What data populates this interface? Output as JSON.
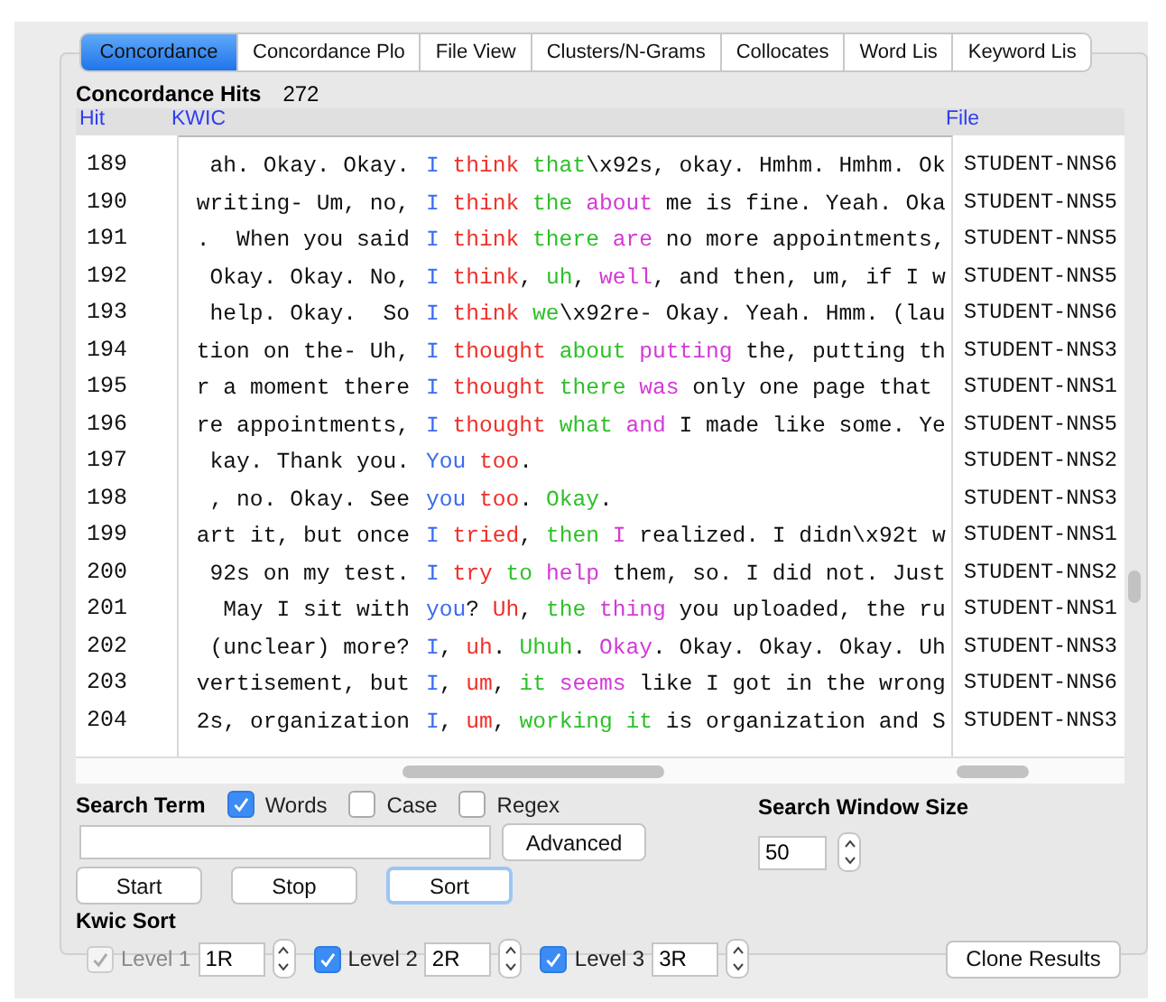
{
  "tabs": [
    {
      "label": "Concordance",
      "selected": true
    },
    {
      "label": "Concordance Plo",
      "selected": false
    },
    {
      "label": "File View",
      "selected": false
    },
    {
      "label": "Clusters/N-Grams",
      "selected": false
    },
    {
      "label": "Collocates",
      "selected": false
    },
    {
      "label": "Word Lis",
      "selected": false
    },
    {
      "label": "Keyword Lis",
      "selected": false
    }
  ],
  "hits": {
    "label": "Concordance Hits",
    "count": "272"
  },
  "table": {
    "columns": [
      "Hit",
      "KWIC",
      "File"
    ],
    "rows": [
      {
        "hit": "189",
        "left": "ah. Okay. Okay.",
        "right": [
          {
            "t": "I ",
            "color": "#3b6cf0"
          },
          {
            "t": "think ",
            "color": "#f0302a"
          },
          {
            "t": "that",
            "color": "#2fc02a"
          },
          {
            "t": "\\x92s, okay. Hmhm. Hmhm. Ok"
          }
        ],
        "file": "STUDENT-NNS6"
      },
      {
        "hit": "190",
        "left": "writing- Um, no,",
        "right": [
          {
            "t": "I ",
            "color": "#3b6cf0"
          },
          {
            "t": "think ",
            "color": "#f0302a"
          },
          {
            "t": "the ",
            "color": "#2fc02a"
          },
          {
            "t": "about",
            "color": "#d23ad6"
          },
          {
            "t": " me is fine. Yeah. Oka"
          }
        ],
        "file": "STUDENT-NNS5"
      },
      {
        "hit": "191",
        "left": ".  When you said",
        "right": [
          {
            "t": "I ",
            "color": "#3b6cf0"
          },
          {
            "t": "think ",
            "color": "#f0302a"
          },
          {
            "t": "there ",
            "color": "#2fc02a"
          },
          {
            "t": "are",
            "color": "#d23ad6"
          },
          {
            "t": " no more appointments,"
          }
        ],
        "file": "STUDENT-NNS5"
      },
      {
        "hit": "192",
        "left": "Okay. Okay. No,",
        "right": [
          {
            "t": "I ",
            "color": "#3b6cf0"
          },
          {
            "t": "think",
            "color": "#f0302a"
          },
          {
            "t": ", "
          },
          {
            "t": "uh",
            "color": "#2fc02a"
          },
          {
            "t": ", "
          },
          {
            "t": "well",
            "color": "#d23ad6"
          },
          {
            "t": ", and then, um, if I w"
          }
        ],
        "file": "STUDENT-NNS5"
      },
      {
        "hit": "193",
        "left": "help. Okay.  So",
        "right": [
          {
            "t": "I ",
            "color": "#3b6cf0"
          },
          {
            "t": "think ",
            "color": "#f0302a"
          },
          {
            "t": "we",
            "color": "#2fc02a"
          },
          {
            "t": "\\x92re- Okay. Yeah. Hmm. (lau"
          }
        ],
        "file": "STUDENT-NNS6"
      },
      {
        "hit": "194",
        "left": "tion on the- Uh,",
        "right": [
          {
            "t": "I ",
            "color": "#3b6cf0"
          },
          {
            "t": "thought ",
            "color": "#f0302a"
          },
          {
            "t": "about ",
            "color": "#2fc02a"
          },
          {
            "t": "putting",
            "color": "#d23ad6"
          },
          {
            "t": " the, putting th"
          }
        ],
        "file": "STUDENT-NNS3"
      },
      {
        "hit": "195",
        "left": "r a moment there",
        "right": [
          {
            "t": "I ",
            "color": "#3b6cf0"
          },
          {
            "t": "thought ",
            "color": "#f0302a"
          },
          {
            "t": "there ",
            "color": "#2fc02a"
          },
          {
            "t": "was",
            "color": "#d23ad6"
          },
          {
            "t": " only one page that"
          }
        ],
        "file": "STUDENT-NNS1"
      },
      {
        "hit": "196",
        "left": "re appointments,",
        "right": [
          {
            "t": "I ",
            "color": "#3b6cf0"
          },
          {
            "t": "thought ",
            "color": "#f0302a"
          },
          {
            "t": "what ",
            "color": "#2fc02a"
          },
          {
            "t": "and",
            "color": "#d23ad6"
          },
          {
            "t": " I made like some. Ye"
          }
        ],
        "file": "STUDENT-NNS5"
      },
      {
        "hit": "197",
        "left": "kay. Thank you.",
        "right": [
          {
            "t": "You ",
            "color": "#3b6cf0"
          },
          {
            "t": "too",
            "color": "#f0302a"
          },
          {
            "t": "."
          }
        ],
        "file": "STUDENT-NNS2"
      },
      {
        "hit": "198",
        "left": ", no. Okay. See",
        "right": [
          {
            "t": "you ",
            "color": "#3b6cf0"
          },
          {
            "t": "too",
            "color": "#f0302a"
          },
          {
            "t": ". "
          },
          {
            "t": "Okay",
            "color": "#2fc02a"
          },
          {
            "t": "."
          }
        ],
        "file": "STUDENT-NNS3"
      },
      {
        "hit": "199",
        "left": "art it, but once",
        "right": [
          {
            "t": "I ",
            "color": "#3b6cf0"
          },
          {
            "t": "tried",
            "color": "#f0302a"
          },
          {
            "t": ", "
          },
          {
            "t": "then ",
            "color": "#2fc02a"
          },
          {
            "t": "I",
            "color": "#d23ad6"
          },
          {
            "t": " realized. I didn\\x92t w"
          }
        ],
        "file": "STUDENT-NNS1"
      },
      {
        "hit": "200",
        "left": "92s on my test.",
        "right": [
          {
            "t": "I ",
            "color": "#3b6cf0"
          },
          {
            "t": "try ",
            "color": "#f0302a"
          },
          {
            "t": "to ",
            "color": "#2fc02a"
          },
          {
            "t": "help",
            "color": "#d23ad6"
          },
          {
            "t": " them, so. I did not. Just"
          }
        ],
        "file": "STUDENT-NNS2"
      },
      {
        "hit": "201",
        "left": " May I sit with",
        "right": [
          {
            "t": "you",
            "color": "#3b6cf0"
          },
          {
            "t": "? "
          },
          {
            "t": "Uh",
            "color": "#f0302a"
          },
          {
            "t": ", "
          },
          {
            "t": "the ",
            "color": "#2fc02a"
          },
          {
            "t": "thing",
            "color": "#d23ad6"
          },
          {
            "t": " you uploaded, the ru"
          }
        ],
        "file": "STUDENT-NNS1"
      },
      {
        "hit": "202",
        "left": "(unclear) more?",
        "right": [
          {
            "t": "I",
            "color": "#3b6cf0"
          },
          {
            "t": ", "
          },
          {
            "t": "uh",
            "color": "#f0302a"
          },
          {
            "t": ". "
          },
          {
            "t": "Uhuh",
            "color": "#2fc02a"
          },
          {
            "t": ". "
          },
          {
            "t": "Okay",
            "color": "#d23ad6"
          },
          {
            "t": ". Okay. Okay. Okay. Uh"
          }
        ],
        "file": "STUDENT-NNS3"
      },
      {
        "hit": "203",
        "left": "vertisement, but",
        "right": [
          {
            "t": "I",
            "color": "#3b6cf0"
          },
          {
            "t": ", "
          },
          {
            "t": "um",
            "color": "#f0302a"
          },
          {
            "t": ", "
          },
          {
            "t": "it ",
            "color": "#2fc02a"
          },
          {
            "t": "seems",
            "color": "#d23ad6"
          },
          {
            "t": " like I got in the wrong"
          }
        ],
        "file": "STUDENT-NNS6"
      },
      {
        "hit": "204",
        "left": "2s, organization",
        "right": [
          {
            "t": "I",
            "color": "#3b6cf0"
          },
          {
            "t": ", "
          },
          {
            "t": "um",
            "color": "#f0302a"
          },
          {
            "t": ", "
          },
          {
            "t": "working it",
            "color": "#2fc02a"
          },
          {
            "t": " is organization and S"
          }
        ],
        "file": "STUDENT-NNS3"
      }
    ]
  },
  "search": {
    "label": "Search Term",
    "options": [
      {
        "label": "Words",
        "checked": true
      },
      {
        "label": "Case",
        "checked": false
      },
      {
        "label": "Regex",
        "checked": false
      }
    ],
    "advanced": "Advanced"
  },
  "window_size": {
    "label": "Search Window Size",
    "value": "50"
  },
  "buttons": [
    {
      "label": "Start",
      "focused": false
    },
    {
      "label": "Stop",
      "focused": false
    },
    {
      "label": "Sort",
      "focused": true
    }
  ],
  "kwic_sort": {
    "label": "Kwic Sort",
    "levels": [
      {
        "label": "Level 1",
        "checked": true,
        "disabled": true,
        "value": "1R"
      },
      {
        "label": "Level 2",
        "checked": true,
        "disabled": false,
        "value": "2R"
      },
      {
        "label": "Level 3",
        "checked": true,
        "disabled": false,
        "value": "3R"
      }
    ]
  },
  "clone": "Clone Results"
}
